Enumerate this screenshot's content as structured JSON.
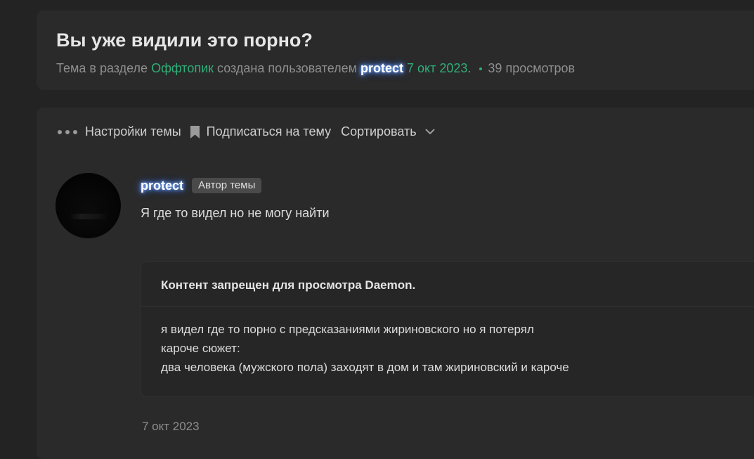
{
  "thread": {
    "title": "Вы уже видили это порно?",
    "meta_prefix": "Тема в разделе",
    "section": "Оффтопик",
    "created_by": "создана пользователем",
    "author": "protect",
    "date": "7 окт 2023",
    "date_suffix": ".",
    "views": "39 просмотров"
  },
  "toolbar": {
    "settings_label": "Настройки темы",
    "subscribe_label": "Подписаться на тему",
    "sort_label": "Сортировать"
  },
  "post": {
    "author": "protect",
    "author_badge": "Автор темы",
    "text": "Я где то видел но не могу найти",
    "restricted_title_prefix": "Контент запрещен для просмотра",
    "restricted_user": "Daemon",
    "restricted_title_suffix": ".",
    "restricted_lines": [
      "я видел где то порно с предсказаниями жириновского но я потерял",
      "кароче сюжет:",
      "два человека (мужского пола) заходят в дом и там жириновский и кароче"
    ],
    "date": "7 окт 2023"
  },
  "colors": {
    "background": "#232323",
    "card": "#2a2a2a",
    "accent_green": "#2fae78",
    "muted_text": "#8e8e8e",
    "username_glow": "#5a8dff"
  },
  "icons": {
    "settings": "dots-icon",
    "subscribe": "bookmark-icon",
    "sort": "chevron-down-icon"
  }
}
